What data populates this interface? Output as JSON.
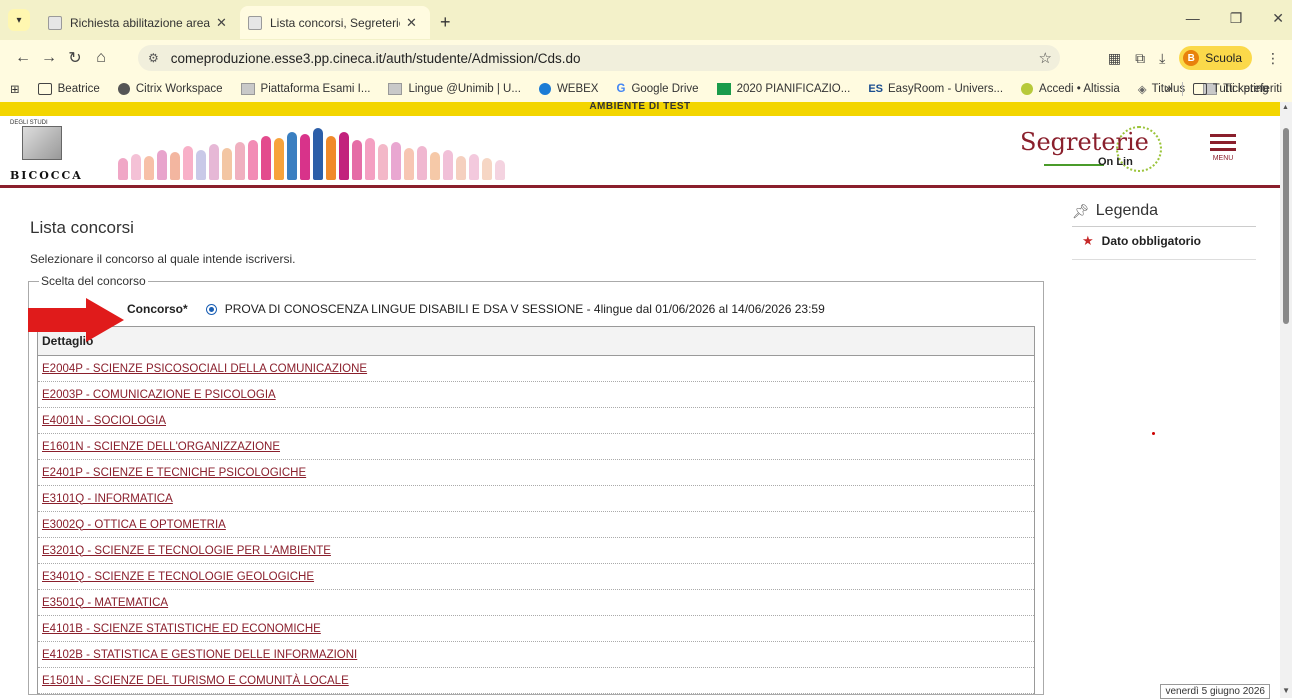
{
  "browser": {
    "tabs": [
      {
        "title": "Richiesta abilitazione area test"
      },
      {
        "title": "Lista concorsi, Segreterie OnLine"
      }
    ],
    "url": "comeproduzione.esse3.pp.cineca.it/auth/studente/Admission/Cds.do",
    "profile": {
      "initial": "B",
      "name": "Scuola"
    },
    "bookmarks": [
      {
        "label": "Beatrice",
        "icon": "folder-icon"
      },
      {
        "label": "Citrix Workspace",
        "icon": "citrix-icon"
      },
      {
        "label": "Piattaforma Esami I...",
        "icon": "page-icon"
      },
      {
        "label": "Lingue @Unimib | U...",
        "icon": "page-icon"
      },
      {
        "label": "WEBEX",
        "icon": "webex-icon"
      },
      {
        "label": "Google Drive",
        "icon": "google-icon"
      },
      {
        "label": "2020 PIANIFICAZIO...",
        "icon": "sheets-icon"
      },
      {
        "label": "EasyRoom - Univers...",
        "icon": "easyroom-icon"
      },
      {
        "label": "Accedi • Altissia",
        "icon": "altissia-icon"
      },
      {
        "label": "Titulus",
        "icon": "titulus-icon"
      },
      {
        "label": "Ticketing",
        "icon": "page-icon"
      }
    ],
    "bookmarks_more": "»",
    "all_bookmarks": "Tutti i preferiti"
  },
  "site": {
    "test_banner": "AMBIENTE DI TEST",
    "uni_logo_top": "DEGLI STUDI",
    "uni_logo_label": "BICOCCA",
    "segreterie_title": "Segreterie",
    "segreterie_sub": "On Lin",
    "menu_label": "MENU"
  },
  "main": {
    "title": "Lista concorsi",
    "subtitle": "Selezionare il concorso al quale intende iscriversi.",
    "fieldset_legend": "Scelta del concorso",
    "concorso_label": "Concorso*",
    "concorso_value": "PROVA DI CONOSCENZA LINGUE DISABILI E DSA V SESSIONE - 4lingue dal 01/06/2026 al 14/06/2026 23:59",
    "table_header": "Dettaglio",
    "rows": [
      "E2004P - SCIENZE PSICOSOCIALI DELLA COMUNICAZIONE",
      "E2003P - COMUNICAZIONE E PSICOLOGIA",
      "E4001N - SOCIOLOGIA",
      "E1601N - SCIENZE DELL'ORGANIZZAZIONE",
      "E2401P - SCIENZE E TECNICHE PSICOLOGICHE",
      "E3101Q - INFORMATICA",
      "E3002Q - OTTICA E OPTOMETRIA",
      "E3201Q - SCIENZE E TECNOLOGIE PER L'AMBIENTE",
      "E3401Q - SCIENZE E TECNOLOGIE GEOLOGICHE",
      "E3501Q - MATEMATICA",
      "E4101B - SCIENZE STATISTICHE ED ECONOMICHE",
      "E4102B - STATISTICA E GESTIONE DELLE INFORMAZIONI",
      "E1501N - SCIENZE DEL TURISMO E COMUNITÀ LOCALE"
    ]
  },
  "legend": {
    "title": "Legenda",
    "item": "Dato obbligatorio"
  },
  "taskbar_date": "venerdì 5 giugno 2026",
  "colors": {
    "brand": "#8a1f2c",
    "banner": "#f3d500",
    "chrome": "#fffbe0",
    "arrow": "#e01b1b"
  }
}
